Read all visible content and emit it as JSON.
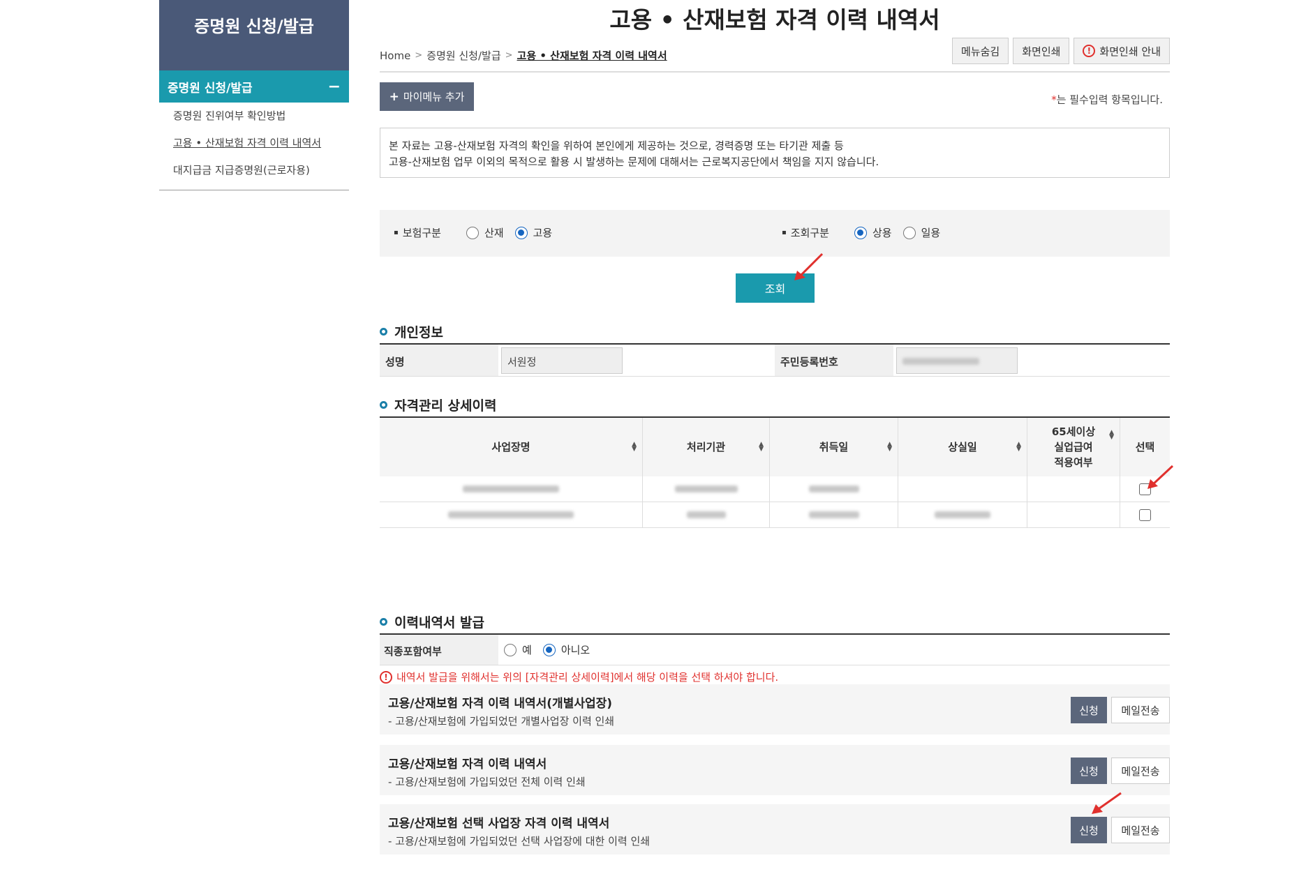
{
  "sidebar": {
    "title": "증명원 신청/발급",
    "active_section": "증명원 신청/발급",
    "items": [
      {
        "label": "증명원 진위여부 확인방법"
      },
      {
        "label": "고용 • 산재보험 자격 이력 내역서"
      },
      {
        "label": "대지급금 지급증명원(근로자용)"
      }
    ]
  },
  "page": {
    "title": "고용 • 산재보험 자격 이력 내역서"
  },
  "breadcrumb": {
    "home": "Home",
    "level1": "증명원 신청/발급",
    "current": "고용 • 산재보험 자격 이력 내역서"
  },
  "top_buttons": {
    "hide_menu": "메뉴숨김",
    "print": "화면인쇄",
    "print_guide": "화면인쇄 안내"
  },
  "mymenu": {
    "label": "마이메뉴 추가"
  },
  "required_note": {
    "star": "*",
    "text": "는 필수입력 항목입니다."
  },
  "notice": {
    "line1": "본 자료는 고용-산재보험 자격의 확인을 위하여 본인에게 제공하는 것으로, 경력증명 또는 타기관 제출 등",
    "line2": "고용-산재보험 업무 이외의 목적으로 활용 시 발생하는 문제에 대해서는 근로복지공단에서 책임을 지지 않습니다."
  },
  "filters": {
    "insurance": {
      "label": "보험구분",
      "options": [
        "산재",
        "고용"
      ],
      "selected": "고용"
    },
    "query": {
      "label": "조회구분",
      "options": [
        "상용",
        "일용"
      ],
      "selected": "상용"
    }
  },
  "search_button": "조회",
  "personal": {
    "section_title": "개인정보",
    "name_label": "성명",
    "name_value": "서원정",
    "rrn_label": "주민등록번호"
  },
  "history": {
    "section_title": "자격관리 상세이력",
    "columns": [
      "사업장명",
      "처리기관",
      "취득일",
      "상실일",
      "65세이상 실업급여 적용여부",
      "선택"
    ],
    "col5_lines": [
      "65세이상",
      "실업급여",
      "적용여부"
    ]
  },
  "issue": {
    "section_title": "이력내역서 발급",
    "job_label": "직종포함여부",
    "job_options": [
      "예",
      "아니오"
    ],
    "job_selected": "아니오",
    "warning": "내역서 발급을 위해서는 위의 [자격관리 상세이력]에서 해당 이력을 선택 하셔야 합니다.",
    "rows": [
      {
        "title": "고용/산재보험 자격 이력 내역서(개별사업장)",
        "desc": "- 고용/산재보험에 가입되었던 개별사업장 이력 인쇄",
        "apply": "신청",
        "mail": "메일전송"
      },
      {
        "title": "고용/산재보험 자격 이력 내역서",
        "desc": "- 고용/산재보험에 가입되었던 전체 이력 인쇄",
        "apply": "신청",
        "mail": "메일전송"
      },
      {
        "title": "고용/산재보험 선택 사업장 자격 이력 내역서",
        "desc": "- 고용/산재보험에 가입되었던 선택 사업장에 대한 이력 인쇄",
        "apply": "신청",
        "mail": "메일전송"
      }
    ]
  },
  "colors": {
    "sidebar_head": "#4a5978",
    "accent_teal": "#1a9aad",
    "button_gray": "#5b667b",
    "warning_red": "#e0302d",
    "radio_blue": "#1565c0"
  }
}
